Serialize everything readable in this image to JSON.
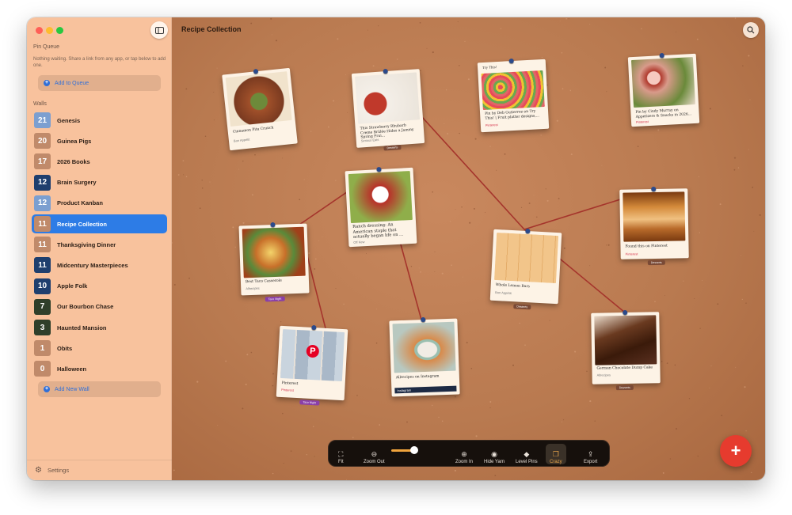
{
  "window": {
    "title": "Recipe Collection"
  },
  "sidebar": {
    "pin_queue_label": "Pin Queue",
    "pin_queue_note": "Nothing waiting. Share a link from any app, or tap below to add one.",
    "add_to_queue_label": "Add to Queue",
    "walls_label": "Walls",
    "walls": [
      {
        "count": "21",
        "name": "Genesis",
        "color": "#7c9fd0"
      },
      {
        "count": "20",
        "name": "Guinea Pigs",
        "color": "#c08a6a"
      },
      {
        "count": "17",
        "name": "2026 Books",
        "color": "#c08a6a"
      },
      {
        "count": "12",
        "name": "Brain Surgery",
        "color": "#1f3f6e"
      },
      {
        "count": "12",
        "name": "Product Kanban",
        "color": "#7c9fd0"
      },
      {
        "count": "11",
        "name": "Recipe Collection",
        "color": "#c08a6a",
        "active": true
      },
      {
        "count": "11",
        "name": "Thanksgiving Dinner",
        "color": "#c08a6a"
      },
      {
        "count": "11",
        "name": "Midcentury Masterpieces",
        "color": "#1f3f6e"
      },
      {
        "count": "10",
        "name": "Apple Folk",
        "color": "#1f3f6e"
      },
      {
        "count": "7",
        "name": "Our Bourbon Chase",
        "color": "#2f3f2a"
      },
      {
        "count": "3",
        "name": "Haunted Mansion",
        "color": "#2f3f2a"
      },
      {
        "count": "1",
        "name": "Obits",
        "color": "#c08a6a"
      },
      {
        "count": "0",
        "name": "Halloween",
        "color": "#c08a6a"
      }
    ],
    "add_wall_label": "Add New Wall",
    "settings_label": "Settings"
  },
  "cards": [
    {
      "title": "Cinnamon Pita Crunch",
      "source": "Bon Appétit",
      "source_style": "plain",
      "tag": "",
      "photo_color": "#8a4a2a"
    },
    {
      "title": "This Strawberry Rhubarb Creme Brûlée Hides a Jammy Spring Frui...",
      "source": "Serious Eats",
      "source_style": "plain",
      "tag": "Desserts",
      "photo_color": "#c0392b"
    },
    {
      "header": "Ranch dressing: An American staple that actually began life on ...",
      "source": "Off Kew",
      "source_style": "plain",
      "tag": "",
      "photo_color": "#b8322a"
    },
    {
      "title": "Pin by Deb Gutierrez on Try This! | Fruit platter designs,...",
      "source": "Pinterest",
      "source_style": "pinterest",
      "tag": "",
      "photo_color": "#c94a3a"
    },
    {
      "title": "Pin by Cindy Murray on Appetizers & Snacks in 2026...",
      "source": "Pinterest",
      "source_style": "pinterest",
      "tag": "",
      "photo_color": "#d89a8a"
    },
    {
      "title": "Found this on Pinterest",
      "source": "Pinterest",
      "source_style": "pinterest",
      "tag": "Desserts",
      "photo_color": "#b86a2a"
    },
    {
      "title": "Best Taco Casserole",
      "source": "Allrecipes",
      "source_style": "plain",
      "tag": "Taco Night",
      "photo_color": "#c8702a"
    },
    {
      "title": "Whole Lemon Bars",
      "source": "Bon Appétit",
      "source_style": "plain",
      "tag": "Desserts",
      "photo_color": "#e8b07a"
    },
    {
      "title": "Pinterest",
      "source": "Pinterest",
      "source_style": "pinterest",
      "tag": "Taco Night",
      "photo_color": "#c9d4de"
    },
    {
      "title": "Allrecipes on Instagram",
      "source": "Instagram",
      "source_style": "plain",
      "tag": "",
      "photo_color": "#d88a4a"
    },
    {
      "title": "German Chocolate Dump Cake",
      "source": "Allrecipes",
      "source_style": "plain",
      "tag": "Desserts",
      "photo_color": "#4a2a1a"
    }
  ],
  "card_headers": {
    "fruit_platter": "Try This!"
  },
  "dock": {
    "fit": "Fit",
    "zoom_out": "Zoom Out",
    "zoom_level": 0.65,
    "zoom_in": "Zoom In",
    "hide_yarn": "Hide Yarn",
    "level_pins": "Level Pins",
    "crazy": "Crazy",
    "export": "Export"
  },
  "colors": {
    "accent": "#2d7ce6",
    "yarn": "#a5352c",
    "fab": "#e63b2e",
    "board": "#b97a50"
  }
}
